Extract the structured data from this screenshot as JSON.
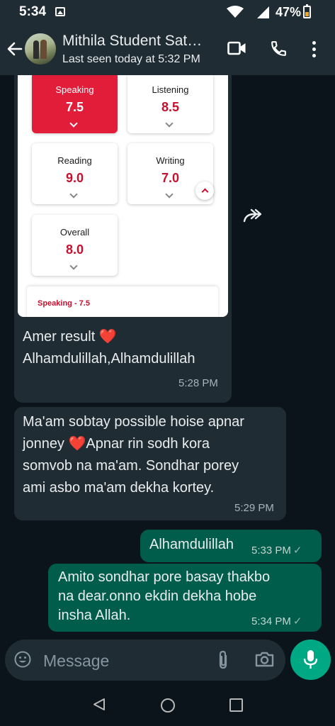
{
  "status_bar": {
    "time": "5:34",
    "battery": "47%"
  },
  "header": {
    "contact_name": "Mithila Student Sat…",
    "status": "Last seen today at 5:32 PM"
  },
  "shared_image": {
    "scores": [
      {
        "label": "Speaking",
        "value": "7.5"
      },
      {
        "label": "Listening",
        "value": "8.5"
      },
      {
        "label": "Reading",
        "value": "9.0"
      },
      {
        "label": "Writing",
        "value": "7.0"
      },
      {
        "label": "Overall",
        "value": "8.0"
      }
    ],
    "footer_label": "Speaking - 7.5"
  },
  "messages": [
    {
      "direction": "in",
      "lines": [
        "Amer result ❤️",
        "Alhamdulillah,Alhamdulillah"
      ],
      "time": "5:28 PM"
    },
    {
      "direction": "in",
      "lines": [
        "Ma'am sobtay possible hoise apnar",
        "jonney ❤️Apnar rin sodh kora",
        "somvob na ma'am. Sondhar porey",
        "ami asbo ma'am dekha kortey."
      ],
      "time": "5:29 PM"
    },
    {
      "direction": "out",
      "lines": [
        "Alhamdulillah"
      ],
      "time": "5:33 PM",
      "status": "✓"
    },
    {
      "direction": "out",
      "lines": [
        "Amito sondhar pore basay thakbo",
        "na dear.onno ekdin dekha hobe",
        "insha Allah."
      ],
      "time": "5:34 PM",
      "status": "✓"
    }
  ],
  "composer": {
    "placeholder": "Message"
  }
}
